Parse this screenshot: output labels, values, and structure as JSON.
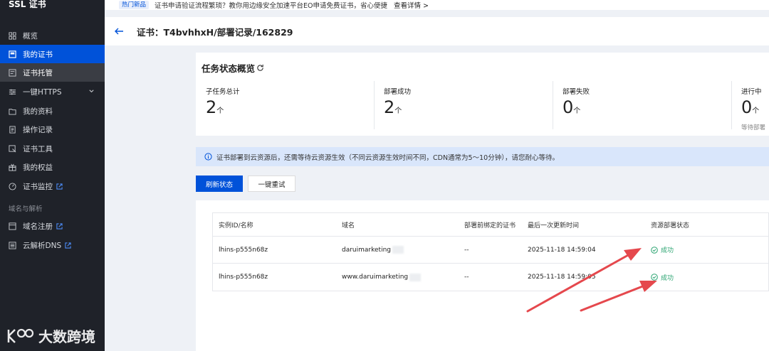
{
  "sidebar": {
    "brand": "SSL 证书",
    "items": [
      {
        "label": "概览",
        "icon": "grid-icon"
      },
      {
        "label": "我的证书",
        "icon": "certificate-icon"
      },
      {
        "label": "证书托管",
        "icon": "hosting-icon"
      },
      {
        "label": "一键HTTPS",
        "icon": "sliders-icon"
      },
      {
        "label": "我的资料",
        "icon": "folder-icon"
      },
      {
        "label": "操作记录",
        "icon": "document-icon"
      },
      {
        "label": "证书工具",
        "icon": "tool-icon"
      },
      {
        "label": "我的权益",
        "icon": "gift-icon"
      },
      {
        "label": "证书监控",
        "icon": "monitor-icon"
      }
    ],
    "group_label": "域名与解析",
    "group_items": [
      {
        "label": "域名注册",
        "icon": "domain-icon"
      },
      {
        "label": "云解析DNS",
        "icon": "dns-icon"
      }
    ]
  },
  "notice": {
    "tag": "热门新品",
    "text": "证书申请验证流程繁琐？教你用边缘安全加速平台EO申请免费证书，省心便捷",
    "link": "查看详情 >"
  },
  "header": {
    "title": "证书：T4bvhhxH/部署记录/162829"
  },
  "overview": {
    "title": "任务状态概览",
    "stats": [
      {
        "label": "子任务总计",
        "value": "2",
        "unit": "个"
      },
      {
        "label": "部署成功",
        "value": "2",
        "unit": "个"
      },
      {
        "label": "部署失败",
        "value": "0",
        "unit": "个"
      },
      {
        "label": "进行中",
        "value": "0",
        "unit": "个",
        "sub": "等待部署"
      }
    ]
  },
  "info": {
    "text": "证书部署到云资源后，还需等待云资源生效（不同云资源生效时间不同，CDN通常为5～10分钟），请您耐心等待。"
  },
  "buttons": {
    "refresh": "刷新状态",
    "retry": "一键重试"
  },
  "table": {
    "headers": [
      "实例ID/名称",
      "域名",
      "部署前绑定的证书",
      "最后一次更新时间",
      "资源部署状态"
    ],
    "rows": [
      {
        "instance": "lhins-p555n68z",
        "domain": "daruimarketing",
        "prev_cert": "--",
        "updated": "2025-11-18 14:59:04",
        "status": "成功"
      },
      {
        "instance": "lhins-p555n68z",
        "domain": "www.daruimarketing",
        "prev_cert": "--",
        "updated": "2025-11-18 14:59:05",
        "status": "成功"
      }
    ]
  },
  "watermark": "大数跨境",
  "colors": {
    "primary": "#0052d9",
    "success": "#2ba471",
    "sidebar_bg": "#1f2229",
    "arrow": "#e5484d"
  }
}
